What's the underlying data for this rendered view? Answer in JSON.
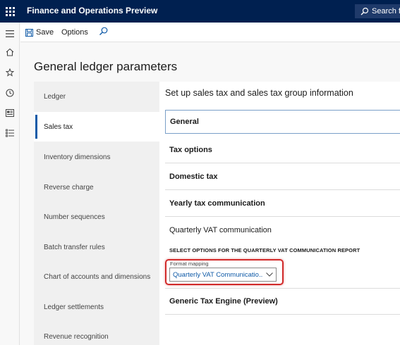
{
  "app": {
    "title": "Finance and Operations Preview",
    "search_label": "Search fo"
  },
  "navrail": {
    "items": [
      "hamburger-icon",
      "home-icon",
      "star-icon",
      "clock-icon",
      "workspace-icon",
      "list-icon"
    ]
  },
  "actionpane": {
    "save_label": "Save",
    "options_label": "Options"
  },
  "page": {
    "title": "General ledger parameters"
  },
  "tabs": [
    {
      "label": "Ledger",
      "active": false
    },
    {
      "label": "Sales tax",
      "active": true
    },
    {
      "label": "Inventory dimensions",
      "active": false
    },
    {
      "label": "Reverse charge",
      "active": false
    },
    {
      "label": "Number sequences",
      "active": false
    },
    {
      "label": "Batch transfer rules",
      "active": false
    },
    {
      "label": "Chart of accounts and dimensions",
      "active": false
    },
    {
      "label": "Ledger settlements",
      "active": false
    },
    {
      "label": "Revenue recognition",
      "active": false
    }
  ],
  "content": {
    "heading": "Set up sales tax and sales tax group information",
    "fasttabs": [
      {
        "label": "General"
      },
      {
        "label": "Tax options"
      },
      {
        "label": "Domestic tax"
      },
      {
        "label": "Yearly tax communication"
      },
      {
        "label": "Quarterly VAT communication"
      },
      {
        "label": "Generic Tax Engine (Preview)"
      }
    ],
    "quarterly": {
      "section_label": "SELECT OPTIONS FOR THE QUARTERLY VAT COMMUNICATION REPORT",
      "field_label": "Format mapping",
      "field_value": "Quarterly VAT Communicatio..."
    }
  },
  "colors": {
    "topbar": "#002050",
    "accent": "#0f5aa7",
    "highlight": "#d12a2a"
  }
}
